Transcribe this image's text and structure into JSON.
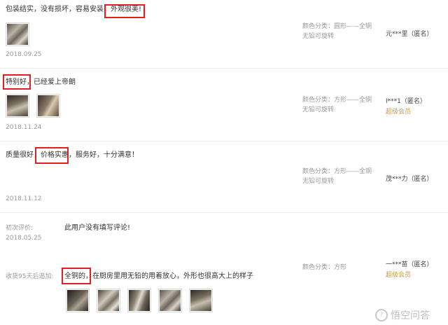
{
  "reviews": [
    {
      "text": "包装结实，没有损坏，容易安装，外观很美!",
      "highlight": "外观很美!",
      "date": "2018.09.25",
      "spec_line1": "颜色分类：圆形——全铜",
      "spec_line2": "无铅可旋转",
      "user": "元***里（匿名）",
      "vip": ""
    },
    {
      "text": "特别好，已经爱上帝朗",
      "highlight": "特别好",
      "date": "2018.11.24",
      "spec_line1": "颜色分类：方形——全铜",
      "spec_line2": "无铅可旋转",
      "user": "I***1（匿名）",
      "vip": "超级会员"
    },
    {
      "text": "质量很好，价格实惠，服务好，十分满意！",
      "highlight": "价格实惠",
      "date": "2018.11.12",
      "spec_line1": "颜色分类：方形——全铜",
      "spec_line2": "无铅可旋转",
      "user": "茂***力（匿名）",
      "vip": ""
    },
    {
      "initial_label": "初次评价:",
      "initial_text": "此用户没有填写评论!",
      "date": "2018.05.25",
      "append_label": "收货95天后追加:",
      "append_text": "全铜的，在厨房里用无铅的用着放心，外形也很高大上的样子",
      "highlight": "全铜的",
      "spec_line1": "颜色分类：方形",
      "user": "一***苗（匿名）",
      "vip": "超级会员"
    }
  ],
  "thumb_icons": [
    "faucet-photo",
    "faucet-photo",
    "kitchen-photo",
    "faucet-photo",
    "faucet-photo",
    "faucet-photo",
    "faucet-photo",
    "faucet-photo"
  ],
  "watermark": "悟空问答",
  "colors": {
    "highlight_border": "#e02020",
    "vip": "#c69a4a",
    "meta": "#999999"
  }
}
